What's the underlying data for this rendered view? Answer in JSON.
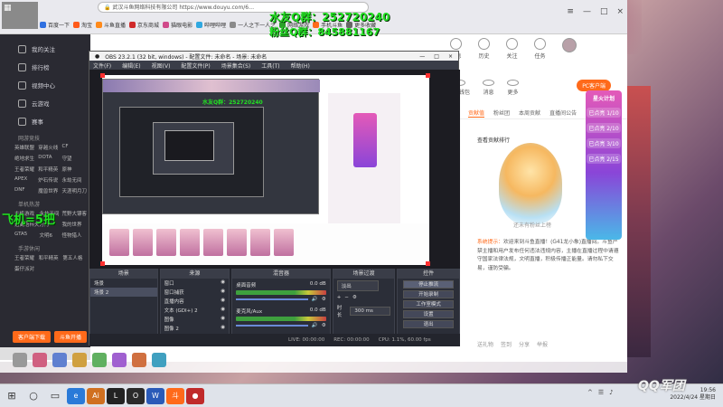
{
  "overlays": {
    "qq_group": "水友Q群：252720240",
    "fan_group": "粉丝Q群：845881167",
    "plane_bet": "飞机=5把",
    "nested_overlay": "水友Q群：252720240"
  },
  "browser": {
    "address": "https://www.douyu.com/6…",
    "company": "武汉斗鱼网络科技有限公司",
    "bookmarks": [
      "百度一下",
      "淘宝",
      "斗鱼直播",
      "京东商城",
      "猫眼电影",
      "哔哩哔哩",
      "一人之下一人之",
      "网络游戏",
      "手机斗鱼",
      "更多收藏"
    ],
    "window_controls": [
      "≡",
      "—",
      "□",
      "×"
    ]
  },
  "page_sidebar": {
    "items": [
      "我的关注",
      "排行榜",
      "视频中心",
      "云游戏",
      "赛事"
    ],
    "section_title": "网游竞技",
    "grid_games": [
      "英雄联盟",
      "穿越火线",
      "CF",
      "绝地求生",
      "DOTA",
      "守望",
      "王者荣耀",
      "和平精英",
      "原神",
      "APEX",
      "炉石传说",
      "永劫无间",
      "DNF",
      "魔兽世界",
      "天涯明月刀"
    ],
    "section_title_2": "单机热游",
    "grid_games_2": [
      "主机游戏",
      "永劫无间",
      "荒野大镖客",
      "逃离塔科夫",
      "方舟",
      "我的世界",
      "GTA5",
      "文明6",
      "怪物猎人"
    ],
    "section_title_3": "手游休闲",
    "grid_games_3": [
      "王者荣耀",
      "和平精英",
      "第五人格",
      "蛋仔派对"
    ],
    "buttons": [
      "客户端下载",
      "斗鱼开播"
    ]
  },
  "page_right": {
    "top_icons": [
      "消息",
      "历史",
      "关注",
      "任务"
    ],
    "toolbar_icons": [
      "我的钱包",
      "消息",
      "更多"
    ],
    "pc_button": "PC客户端",
    "tabs": [
      "主播",
      "贡献值",
      "粉丝团",
      "本周贡献",
      "直播间公告"
    ],
    "rank_link": "查看贡献排行",
    "mascot_caption": "还未有粉丝上榜",
    "system_msg_label": "系统提示：",
    "system_msg": "欢迎来到斗鱼直播！(G41龙小象)直播间。斗鱼严禁主播和用户发布任何违法违规内容，主播在直播过程中请遵守国家法律法规，文明直播，积极传播正能量。请勿私下交易，谨防受骗。",
    "footer": [
      "送礼物",
      "签到",
      "分享",
      "举报"
    ]
  },
  "promo": {
    "title": "星火计划",
    "items": [
      "已点亮 1/10",
      "已点亮 2/10",
      "已点亮 3/10",
      "已点亮 2/15"
    ]
  },
  "obs": {
    "title": "OBS 23.2.1 (32 bit, windows) - 配置文件: 未命名 - 场景: 未命名",
    "title_ctrls": [
      "—",
      "□",
      "×"
    ],
    "menu": [
      "文件(F)",
      "编辑(E)",
      "视图(V)",
      "配置文件(P)",
      "场景集合(S)",
      "工具(T)",
      "帮助(H)"
    ],
    "docks": {
      "scenes": {
        "title": "场景",
        "items": [
          "场景",
          "场景 2"
        ]
      },
      "sources": {
        "title": "来源",
        "items": [
          "窗口",
          "窗口捕获",
          "直播内容",
          "文本 (GDI+) 2",
          "图像",
          "图像 2"
        ]
      },
      "mixer": {
        "title": "混音器",
        "channels": [
          {
            "name": "桌面音频",
            "db": "0.0 dB"
          },
          {
            "name": "麦克风/Aux",
            "db": "0.0 dB"
          }
        ]
      },
      "transitions": {
        "title": "场景过渡",
        "type": "淡出",
        "duration_label": "时长",
        "duration": "300 ms"
      },
      "controls": {
        "title": "控件",
        "buttons": [
          "停止推流",
          "开始录制",
          "工作室模式",
          "设置",
          "退出"
        ]
      }
    },
    "status": [
      "LIVE: 00:00:00",
      "REC: 00:00:00",
      "CPU: 1.1%, 60.00 fps"
    ]
  },
  "taskbar": {
    "apps": [
      "e",
      "Ai",
      "L",
      "O",
      "W",
      "斗",
      "●"
    ],
    "watermark": "QQ军团",
    "time": "19:56",
    "date": "2022/4/24 星期日"
  },
  "colors": {
    "accent_orange": "#ff6a1a",
    "overlay_green": "#22e022",
    "obs_dark": "#2b2e38"
  }
}
